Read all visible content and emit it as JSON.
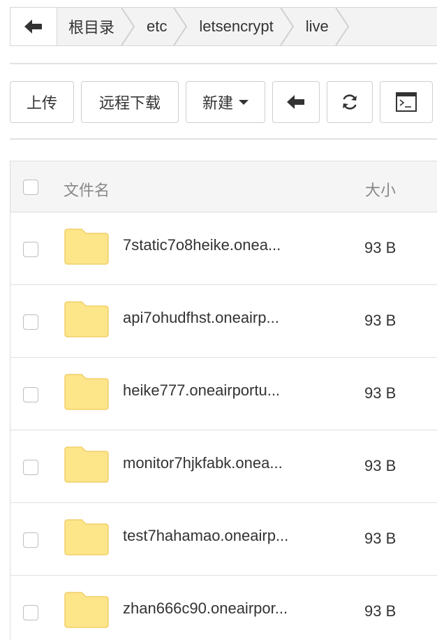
{
  "breadcrumb": {
    "items": [
      {
        "label": "根目录"
      },
      {
        "label": "etc"
      },
      {
        "label": "letsencrypt"
      },
      {
        "label": "live"
      }
    ]
  },
  "toolbar": {
    "upload_label": "上传",
    "remote_download_label": "远程下载",
    "new_label": "新建",
    "back_icon": "arrow-left-icon",
    "refresh_icon": "refresh-icon",
    "terminal_icon": "terminal-icon"
  },
  "table": {
    "headers": {
      "name": "文件名",
      "size": "大小"
    },
    "rows": [
      {
        "name": "7static7o8heike.onea...",
        "size": "93 B"
      },
      {
        "name": "api7ohudfhst.oneairp...",
        "size": "93 B"
      },
      {
        "name": "heike777.oneairportu...",
        "size": "93 B"
      },
      {
        "name": "monitor7hjkfabk.onea...",
        "size": "93 B"
      },
      {
        "name": "test7hahamao.oneairp...",
        "size": "93 B"
      },
      {
        "name": "zhan666c90.oneairpor...",
        "size": "93 B"
      }
    ]
  },
  "colors": {
    "folder_fill": "#fde58a",
    "folder_stroke": "#f2d06a"
  }
}
